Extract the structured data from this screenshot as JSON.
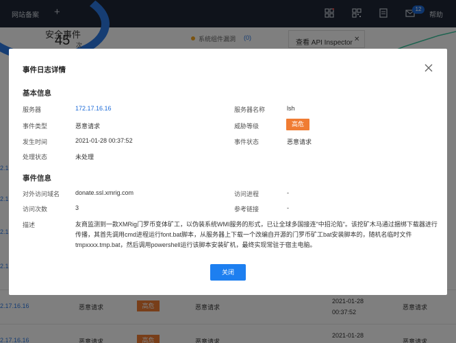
{
  "topbar": {
    "tab_label": "网站备案",
    "plus": "+",
    "notification_count": "12",
    "help_label": "帮助"
  },
  "background": {
    "stat_title": "安全事件",
    "stat_value": "45",
    "stat_unit": "次",
    "legend_label": "系统组件漏洞",
    "legend_count": "(0)",
    "inspector_tab": "查看 API Inspector",
    "rows": [
      {
        "ip": "2.17.16.16",
        "type": "恶意请求",
        "level": "高危",
        "status": "恶意请求",
        "date": "2021-01-28",
        "time": "00:37:52",
        "result": "恶意请求"
      },
      {
        "ip": "2.17.16.16",
        "type": "恶意请求",
        "level": "高危",
        "status": "恶意请求",
        "date": "2021-01-28",
        "time": "",
        "result": "恶意请求"
      }
    ],
    "edge_labels": [
      "2.17",
      "2.17",
      "2.17",
      "2.17"
    ]
  },
  "modal": {
    "title": "事件日志详情",
    "basic_section": "基本信息",
    "server_label": "服务器",
    "server_value": "172.17.16.16",
    "server_name_label": "服务器名称",
    "server_name_value": "lsh",
    "event_type_label": "事件类型",
    "event_type_value": "恶意请求",
    "threat_level_label": "威胁等级",
    "threat_level_value": "高危",
    "occur_time_label": "发生时间",
    "occur_time_value": "2021-01-28 00:37:52",
    "event_status_label": "事件状态",
    "event_status_value": "恶意请求",
    "handle_status_label": "处理状态",
    "handle_status_value": "未处理",
    "event_section": "事件信息",
    "domain_label": "对外访问域名",
    "domain_value": "donate.ssl.xmrig.com",
    "process_label": "访问进程",
    "process_value": "-",
    "count_label": "访问次数",
    "count_value": "3",
    "ref_label": "参考链接",
    "ref_value": "-",
    "desc_label": "描述",
    "desc_value": "友商监测到一款XMRig门罗币变体矿工，以伪装系统WMI服务的形式，已让全球多国接连\"中招沦陷\"。该挖矿木马通过捆绑下载器进行传播，其首先调用cmd进程运行font.bat脚本，从服务器上下载一个改编自开源的门罗币矿工bat安装脚本的，随机名临时文件tmpxxxx.tmp.bat，然后调用powershell运行该脚本安装矿机，最终实现常驻于宿主电脑。",
    "close_button": "关闭"
  },
  "colors": {
    "topbar": "#1e2736",
    "primary": "#1d7ff0",
    "danger_tag": "#f07c33"
  }
}
